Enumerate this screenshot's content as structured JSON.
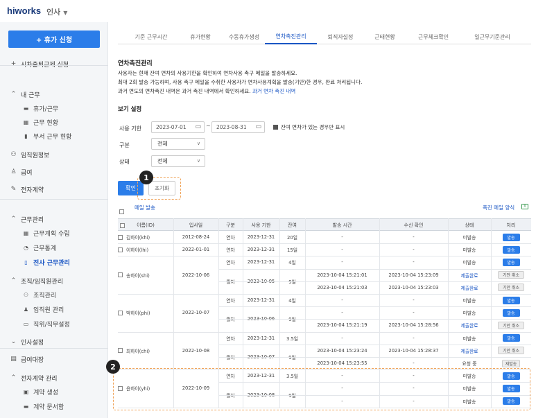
{
  "app": {
    "logo": "hiworks",
    "menu": "인사",
    "menu_caret": "▼"
  },
  "sidebar": {
    "vacation_button": "+ 휴가 신청",
    "attendance_request": "시차출퇴근제 신청",
    "sections": [
      {
        "label": "내 근무",
        "icon": "chevron-up-icon"
      },
      {
        "label": "휴가/근무"
      },
      {
        "label": "근무 현황"
      },
      {
        "label": "부서 근무 현황"
      },
      {
        "label": "임직원정보"
      },
      {
        "label": "급여"
      },
      {
        "label": "전자계약"
      },
      {
        "label": "근무관리"
      },
      {
        "label": "근무계획 수립"
      },
      {
        "label": "근무통계"
      },
      {
        "label": "전사 근무관리"
      },
      {
        "label": "조직/임직원관리"
      },
      {
        "label": "조직관리"
      },
      {
        "label": "임직원 관리"
      },
      {
        "label": "직위/직무설정"
      },
      {
        "label": "인사설정"
      },
      {
        "label": "급여대장"
      },
      {
        "label": "전자계약 관리"
      },
      {
        "label": "계약 생성"
      },
      {
        "label": "계약 문서함"
      }
    ]
  },
  "tabs": [
    "기준 근무시간",
    "휴가현황",
    "수동휴가생성",
    "연차촉진관리",
    "퇴직자설정",
    "근태현황",
    "근무체크확인",
    "일근무기준관리"
  ],
  "active_tab_index": 3,
  "page": {
    "title": "연차촉진관리",
    "desc1": "사용자는 현재 잔여 연차의 사용기한을 확인하여 연차사용 촉구 메일을 발송하세요.",
    "desc2": "최대 2회 발송 가능하며, 사용 촉구 메일을 수취한 사용자가 연차사용계획을 발송(기안)한 경우, 완료 처리됩니다.",
    "desc3": "과거 연도의 연차촉진 내역은 과거 촉진 내역에서 확인하세요.",
    "desc3_link": "과거 연차 촉진 내역",
    "filter_title": "보기 설정",
    "period_label": "사용 기한",
    "date_from": "2023-07-01",
    "date_to": "2023-08-31",
    "tilde": "~",
    "remaining_only": "잔여 연차가 있는 경우만 표시",
    "type_label": "구분",
    "type_value": "전체",
    "status_label": "상태",
    "status_value": "전체",
    "confirm": "확인",
    "reset": "초기화",
    "mail_link": "메일 발송",
    "send_form": "촉진 메일 양식",
    "xls": "X",
    "badge1": "1",
    "badge2": "2"
  },
  "table": {
    "headers": [
      "이름(ID)",
      "입사일",
      "구분",
      "사용 기한",
      "잔여",
      "발송 시간",
      "수신 확인",
      "상태",
      "처리"
    ],
    "rows": [
      {
        "name": "김하이(khi)",
        "join": "2012-08-24",
        "type": "연차",
        "deadline": "2023-12-31",
        "remain": "20일",
        "sent": "-",
        "recv": "-",
        "status": "미발송",
        "action": "발송"
      },
      {
        "name": "이하이(lhi)",
        "join": "2022-01-01",
        "type": "연차",
        "deadline": "2023-12-31",
        "remain": "15일",
        "sent": "-",
        "recv": "-",
        "status": "미발송",
        "action": "발송"
      },
      {
        "name": "송하이(shi)",
        "join": "2022-10-06",
        "type": "연차",
        "deadline": "2023-12-31",
        "remain": "4일",
        "sent": "-",
        "recv": "-",
        "status": "미발송",
        "action": "발송"
      },
      {
        "name": "",
        "join": "",
        "type": "월차",
        "deadline": "2023-10-05",
        "remain": "9일",
        "sent": "2023-10-04 15:21:01",
        "recv": "2023-10-04 15:23:09",
        "status": "제출완료",
        "action": "기안 취소"
      },
      {
        "name": "",
        "join": "",
        "type": "",
        "deadline": "",
        "remain": "",
        "sent": "2023-10-04 15:21:03",
        "recv": "2023-10-04 15:23:03",
        "status": "제출완료",
        "action": "기안 취소"
      },
      {
        "name": "박하이(phi)",
        "join": "2022-10-07",
        "type": "연차",
        "deadline": "2023-12-31",
        "remain": "4일",
        "sent": "-",
        "recv": "-",
        "status": "미발송",
        "action": "발송"
      },
      {
        "name": "",
        "join": "",
        "type": "월차",
        "deadline": "2023-10-06",
        "remain": "9일",
        "sent": "-",
        "recv": "-",
        "status": "미발송",
        "action": "발송"
      },
      {
        "name": "",
        "join": "",
        "type": "",
        "deadline": "",
        "remain": "",
        "sent": "2023-10-04 15:21:19",
        "recv": "2023-10-04 15:28:56",
        "status": "제출완료",
        "action": "기안 취소"
      },
      {
        "name": "최하이(chi)",
        "join": "2022-10-08",
        "type": "연차",
        "deadline": "2023-12-31",
        "remain": "3.5일",
        "sent": "-",
        "recv": "-",
        "status": "미발송",
        "action": "발송"
      },
      {
        "name": "",
        "join": "",
        "type": "월차",
        "deadline": "2023-10-07",
        "remain": "9일",
        "sent": "2023-10-04 15:23:24",
        "recv": "2023-10-04 15:28:37",
        "status": "제출완료",
        "action": "기안 취소"
      },
      {
        "name": "",
        "join": "",
        "type": "",
        "deadline": "",
        "remain": "",
        "sent": "2023-10-04 15:23:55",
        "recv": "-",
        "status": "요청 중",
        "action": "재발송"
      },
      {
        "name": "윤하이(yhi)",
        "join": "2022-10-09",
        "type": "연차",
        "deadline": "2023-12-31",
        "remain": "3.5일",
        "sent": "-",
        "recv": "-",
        "status": "미발송",
        "action": "발송"
      },
      {
        "name": "",
        "join": "",
        "type": "월차",
        "deadline": "2023-10-08",
        "remain": "9일",
        "sent": "-",
        "recv": "-",
        "status": "미발송",
        "action": "발송"
      },
      {
        "name": "",
        "join": "",
        "type": "",
        "deadline": "",
        "remain": "",
        "sent": "-",
        "recv": "-",
        "status": "미발송",
        "action": "발송"
      }
    ]
  }
}
